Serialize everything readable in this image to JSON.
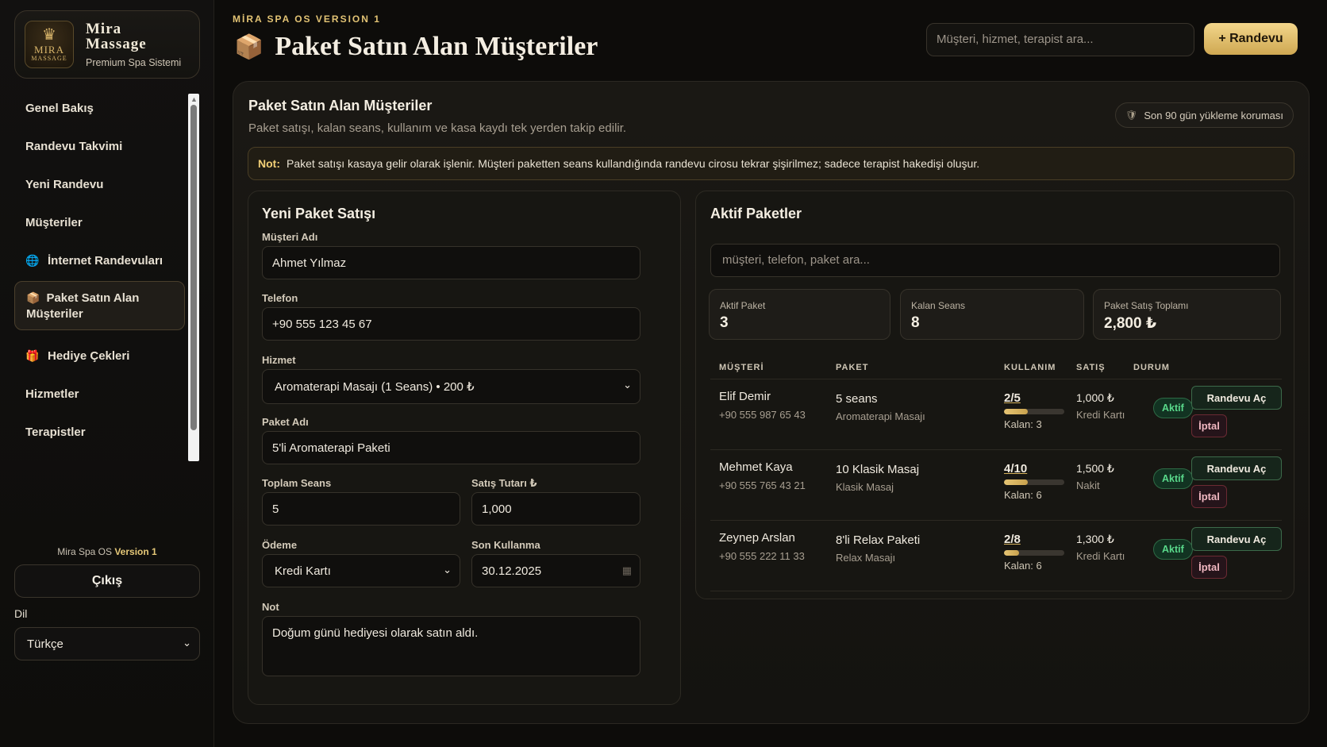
{
  "brand": {
    "logo_line1": "MIRA",
    "logo_line2": "MASSAGE",
    "name_line1": "Mira",
    "name_line2": "Massage",
    "subtitle": "Premium Spa Sistemi"
  },
  "sidebar": {
    "items": [
      {
        "label": "Genel Bakış",
        "icon": ""
      },
      {
        "label": "Randevu Takvimi",
        "icon": ""
      },
      {
        "label": "Yeni Randevu",
        "icon": ""
      },
      {
        "label": "Müşteriler",
        "icon": ""
      },
      {
        "label": "İnternet Randevuları",
        "icon": "globe-icon"
      },
      {
        "label": "Paket Satın Alan Müşteriler",
        "icon": "package-icon",
        "active": true
      },
      {
        "label": "Hediye Çekleri",
        "icon": "gift-icon"
      },
      {
        "label": "Hizmetler",
        "icon": ""
      },
      {
        "label": "Terapistler",
        "icon": ""
      }
    ],
    "version_prefix": "Mira Spa OS",
    "version": "Version 1",
    "logout": "Çıkış",
    "language_label": "Dil",
    "language_value": "Türkçe"
  },
  "header": {
    "eyebrow": "MİRA SPA OS VERSION 1",
    "title": "Paket Satın Alan Müşteriler",
    "search_placeholder": "Müşteri, hizmet, terapist ara...",
    "new_appointment": "+ Randevu"
  },
  "panel": {
    "title": "Paket Satın Alan Müşteriler",
    "description": "Paket satışı, kalan seans, kullanım ve kasa kaydı tek yerden takip edilir.",
    "guard_label": "Son 90 gün yükleme koruması",
    "note_label": "Not:",
    "note_text": "Paket satışı kasaya gelir olarak işlenir. Müşteri paketten seans kullandığında randevu cirosu tekrar şişirilmez; sadece terapist hakedişi oluşur."
  },
  "form": {
    "title": "Yeni Paket Satışı",
    "customer_label": "Müşteri Adı",
    "customer_value": "Ahmet Yılmaz",
    "phone_label": "Telefon",
    "phone_value": "+90 555 123 45 67",
    "service_label": "Hizmet",
    "service_value": "Aromaterapi Masajı (1 Seans) • 200 ₺",
    "package_label": "Paket Adı",
    "package_value": "5'li Aromaterapi Paketi",
    "sessions_label": "Toplam Seans",
    "sessions_value": "5",
    "amount_label": "Satış Tutarı ₺",
    "amount_value": "1,000",
    "payment_label": "Ödeme",
    "payment_value": "Kredi Kartı",
    "expiry_label": "Son Kullanma",
    "expiry_value": "30.12.2025",
    "note_label": "Not",
    "note_value": "Doğum günü hediyesi olarak satın aldı."
  },
  "packages": {
    "title": "Aktif Paketler",
    "search_placeholder": "müşteri, telefon, paket ara...",
    "stats": [
      {
        "label": "Aktif Paket",
        "value": "3"
      },
      {
        "label": "Kalan Seans",
        "value": "8"
      },
      {
        "label": "Paket Satış Toplamı",
        "value": "2,800 ₺"
      }
    ],
    "columns": [
      "MÜŞTERİ",
      "PAKET",
      "KULLANIM",
      "SATIŞ",
      "DURUM"
    ],
    "rows": [
      {
        "name": "Elif Demir",
        "phone": "+90 555 987 65 43",
        "package": "5 seans",
        "service": "Aromaterapi Masajı",
        "usage": "2/5",
        "progress": 0.4,
        "remaining": "Kalan: 3",
        "amount": "1,000 ₺",
        "payment": "Kredi Kartı",
        "status": "Aktif",
        "open_label": "Randevu Aç",
        "cancel_label": "İptal"
      },
      {
        "name": "Mehmet Kaya",
        "phone": "+90 555 765 43 21",
        "package": "10 Klasik Masaj",
        "service": "Klasik Masaj",
        "usage": "4/10",
        "progress": 0.4,
        "remaining": "Kalan: 6",
        "amount": "1,500 ₺",
        "payment": "Nakit",
        "status": "Aktif",
        "open_label": "Randevu Aç",
        "cancel_label": "İptal"
      },
      {
        "name": "Zeynep Arslan",
        "phone": "+90 555 222 11 33",
        "package": "8'li Relax Paketi",
        "service": "Relax Masajı",
        "usage": "2/8",
        "progress": 0.25,
        "remaining": "Kalan: 6",
        "amount": "1,300 ₺",
        "payment": "Kredi Kartı",
        "status": "Aktif",
        "open_label": "Randevu Aç",
        "cancel_label": "İptal"
      }
    ]
  },
  "colors": {
    "background": "#0d0c0a",
    "accent_gold": "#e2c374",
    "status_green": "#59d88a",
    "cancel_red": "#f0b7c0"
  }
}
